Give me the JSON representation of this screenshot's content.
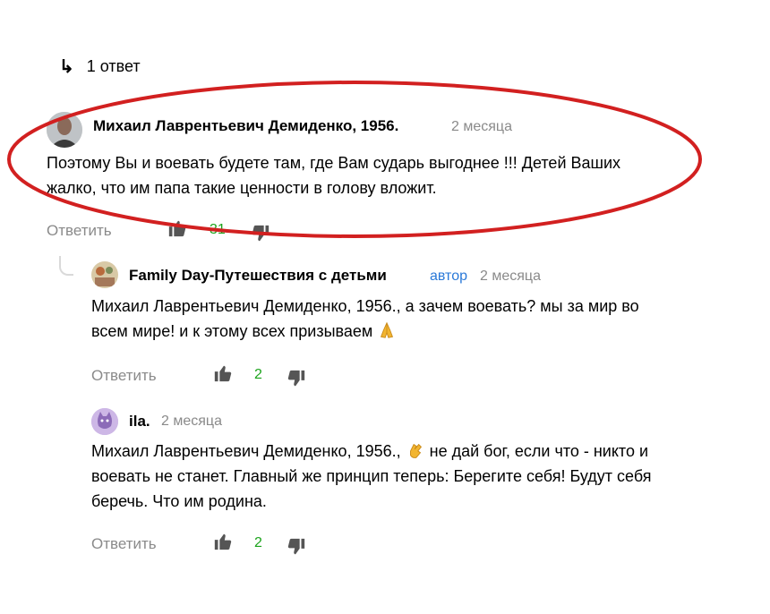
{
  "replies_toggle": {
    "label": "1 ответ"
  },
  "colors": {
    "highlight_ellipse": "#d22020",
    "like_count": "#1ca31c",
    "author_badge": "#2a79d8",
    "muted": "#8a8a8a"
  },
  "comments": [
    {
      "author": "Михаил Лаврентьевич Демиденко, 1956.",
      "time": "2 месяца",
      "text_line1": "Поэтому Вы и воевать будете там, где Вам сударь выгоднее !!! Детей Ваших",
      "text_line2": "жалко, что им папа такие ценности в голову вложит.",
      "reply_label": "Ответить",
      "likes": "31"
    },
    {
      "author": "Family Day-Путешествия с детьми",
      "badge": "автор",
      "time": "2 месяца",
      "text_line1": "Михаил Лаврентьевич Демиденко, 1956., а зачем воевать? мы за мир во",
      "text_line2": "всем мире! и к этому всех призываем",
      "emoji": "folded-hands-emoji",
      "reply_label": "Ответить",
      "likes": "2"
    },
    {
      "author": "ila.",
      "time": "2 месяца",
      "text_line1a": "Михаил Лаврентьевич Демиденко, 1956.,",
      "emoji": "clapping-hands-emoji",
      "text_line1b": "не дай бог, если что - никто и",
      "text_line2": "воевать не станет. Главный же принцип теперь: Берегите себя! Будут себя",
      "text_line3": "беречь. Что им родина.",
      "reply_label": "Ответить",
      "likes": "2"
    }
  ]
}
